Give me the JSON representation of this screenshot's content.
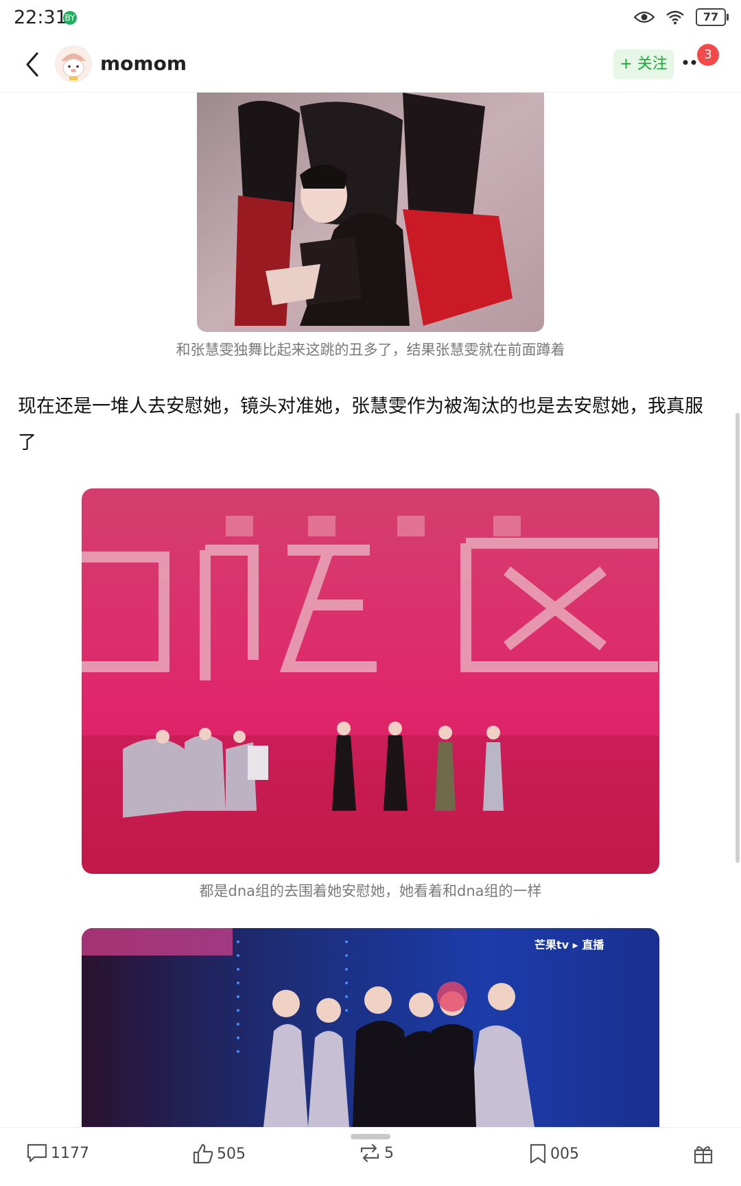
{
  "status": {
    "time": "22:31",
    "app_badge": "BY",
    "battery": "77"
  },
  "header": {
    "username": "momom",
    "follow_label": "+ 关注",
    "notification_count": "3"
  },
  "post": {
    "caption1": "和张慧雯独舞比起来这跳的丑多了，结果张慧雯就在前面蹲着",
    "paragraph": "现在还是一堆人去安慰她，镜头对准她，张慧雯作为被淘汰的也是去安慰她，我真服了",
    "caption2": "都是dna组的去围着她安慰她，她看着和dna组的一样",
    "image3_watermark": "芒果tv ▸ 直播"
  },
  "actions": {
    "comments": "1177",
    "likes": "505",
    "reposts": "5",
    "favorites": "005"
  }
}
